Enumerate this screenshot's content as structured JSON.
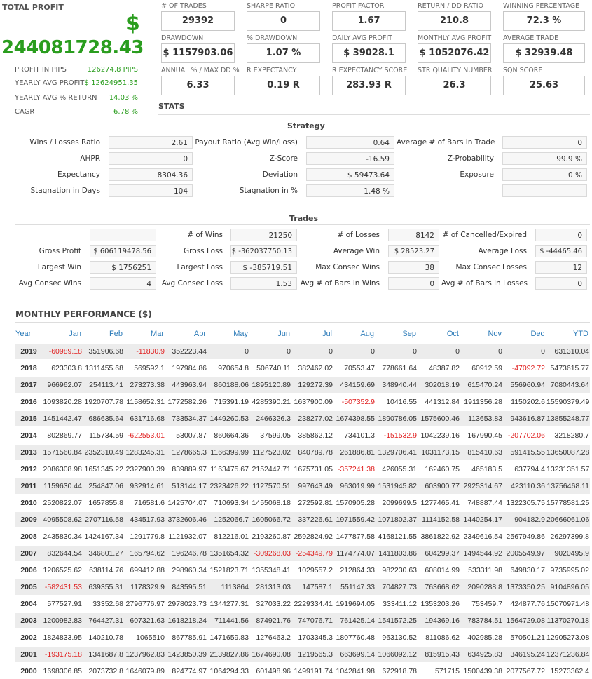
{
  "total_profit": {
    "title": "TOTAL PROFIT",
    "currency": "$",
    "value": "244081728.43"
  },
  "profit_stats": [
    {
      "label": "PROFIT IN PIPS",
      "value": "126274.8 PIPS"
    },
    {
      "label": "YEARLY AVG PROFIT",
      "value": "$ 12624951.35"
    },
    {
      "label": "YEARLY AVG % RETURN",
      "value": "14.03 %"
    },
    {
      "label": "CAGR",
      "value": "6.78 %"
    }
  ],
  "metrics": [
    {
      "label": "# OF TRADES",
      "value": "29392"
    },
    {
      "label": "SHARPE RATIO",
      "value": "0"
    },
    {
      "label": "PROFIT FACTOR",
      "value": "1.67"
    },
    {
      "label": "RETURN / DD RATIO",
      "value": "210.8"
    },
    {
      "label": "WINNING PERCENTAGE",
      "value": "72.3 %"
    },
    {
      "label": "DRAWDOWN",
      "value": "$ 1157903.06"
    },
    {
      "label": "% DRAWDOWN",
      "value": "1.07 %"
    },
    {
      "label": "DAILY AVG PROFIT",
      "value": "$ 39028.1"
    },
    {
      "label": "MONTHLY AVG PROFIT",
      "value": "$ 1052076.42"
    },
    {
      "label": "AVERAGE TRADE",
      "value": "$ 32939.48"
    },
    {
      "label": "ANNUAL % / MAX DD %",
      "value": "6.33"
    },
    {
      "label": "R EXPECTANCY",
      "value": "0.19 R"
    },
    {
      "label": "R EXPECTANCY SCORE",
      "value": "283.93 R"
    },
    {
      "label": "STR QUALITY NUMBER",
      "value": "26.3"
    },
    {
      "label": "SQN SCORE",
      "value": "25.63"
    }
  ],
  "stats_heading": "STATS",
  "strategy": {
    "title": "Strategy",
    "rows": [
      [
        {
          "label": "Wins / Losses Ratio",
          "value": "2.61"
        },
        {
          "label": "Payout Ratio (Avg Win/Loss)",
          "value": "0.64"
        },
        {
          "label": "Average # of Bars in Trade",
          "value": "0"
        }
      ],
      [
        {
          "label": "AHPR",
          "value": "0"
        },
        {
          "label": "Z-Score",
          "value": "-16.59"
        },
        {
          "label": "Z-Probability",
          "value": "99.9 %"
        }
      ],
      [
        {
          "label": "Expectancy",
          "value": "8304.36"
        },
        {
          "label": "Deviation",
          "value": "$ 59473.64"
        },
        {
          "label": "Exposure",
          "value": "0 %"
        }
      ],
      [
        {
          "label": "Stagnation in Days",
          "value": "104"
        },
        {
          "label": "Stagnation in %",
          "value": "1.48 %"
        },
        {
          "label": "",
          "value": ""
        }
      ]
    ]
  },
  "trades": {
    "title": "Trades",
    "rows": [
      [
        {
          "label": "",
          "value": ""
        },
        {
          "label": "# of Wins",
          "value": "21250"
        },
        {
          "label": "# of Losses",
          "value": "8142"
        },
        {
          "label": "# of Cancelled/Expired",
          "value": "0"
        }
      ],
      [
        {
          "label": "Gross Profit",
          "value": "$ 606119478.56"
        },
        {
          "label": "Gross Loss",
          "value": "$ -362037750.13"
        },
        {
          "label": "Average Win",
          "value": "$ 28523.27"
        },
        {
          "label": "Average Loss",
          "value": "$ -44465.46"
        }
      ],
      [
        {
          "label": "Largest Win",
          "value": "$ 1756251"
        },
        {
          "label": "Largest Loss",
          "value": "$ -385719.51"
        },
        {
          "label": "Max Consec Wins",
          "value": "38"
        },
        {
          "label": "Max Consec Losses",
          "value": "12"
        }
      ],
      [
        {
          "label": "Avg Consec Wins",
          "value": "4"
        },
        {
          "label": "Avg Consec Loss",
          "value": "1.53"
        },
        {
          "label": "Avg # of Bars in Wins",
          "value": "0"
        },
        {
          "label": "Avg # of Bars in Losses",
          "value": "0"
        }
      ]
    ]
  },
  "monthly": {
    "title": "MONTHLY PERFORMANCE ($)",
    "headers": [
      "Year",
      "Jan",
      "Feb",
      "Mar",
      "Apr",
      "May",
      "Jun",
      "Jul",
      "Aug",
      "Sep",
      "Oct",
      "Nov",
      "Dec",
      "YTD"
    ],
    "rows": [
      [
        "2019",
        "-60989.18",
        "351906.68",
        "-11830.9",
        "352223.44",
        "0",
        "0",
        "0",
        "0",
        "0",
        "0",
        "0",
        "0",
        "631310.04"
      ],
      [
        "2018",
        "623303.8",
        "1311455.68",
        "569592.1",
        "197984.86",
        "970654.8",
        "506740.11",
        "382462.02",
        "70553.47",
        "778661.64",
        "48387.82",
        "60912.59",
        "-47092.72",
        "5473615.77"
      ],
      [
        "2017",
        "966962.07",
        "254113.41",
        "273273.38",
        "443963.94",
        "860188.06",
        "1895120.89",
        "129272.39",
        "434159.69",
        "348940.44",
        "302018.19",
        "615470.24",
        "556960.94",
        "7080443.64"
      ],
      [
        "2016",
        "1093820.28",
        "1920707.78",
        "1158652.31",
        "1772582.26",
        "715391.19",
        "4285390.21",
        "1637900.09",
        "-507352.9",
        "10416.55",
        "441312.84",
        "1911356.28",
        "1150202.6",
        "15590379.49"
      ],
      [
        "2015",
        "1451442.47",
        "686635.64",
        "631716.68",
        "733534.37",
        "1449260.53",
        "2466326.3",
        "238277.02",
        "1674398.55",
        "1890786.05",
        "1575600.46",
        "113653.83",
        "943616.87",
        "13855248.77"
      ],
      [
        "2014",
        "802869.77",
        "115734.59",
        "-622553.01",
        "53007.87",
        "860664.36",
        "37599.05",
        "385862.12",
        "734101.3",
        "-151532.9",
        "1042239.16",
        "167990.45",
        "-207702.06",
        "3218280.7"
      ],
      [
        "2013",
        "1571560.84",
        "2352310.49",
        "1283245.31",
        "1278665.3",
        "1166399.99",
        "1127523.02",
        "840789.78",
        "261886.81",
        "1329706.41",
        "1031173.15",
        "815410.63",
        "591415.55",
        "13650087.28"
      ],
      [
        "2012",
        "2086308.98",
        "1651345.22",
        "2327900.39",
        "839889.97",
        "1163475.67",
        "2152447.71",
        "1675731.05",
        "-357241.38",
        "426055.31",
        "162460.75",
        "465183.5",
        "637794.4",
        "13231351.57"
      ],
      [
        "2011",
        "1159630.44",
        "254847.06",
        "932914.61",
        "513144.17",
        "2323426.22",
        "1127570.51",
        "997643.49",
        "963019.99",
        "1531945.82",
        "603900.77",
        "2925314.67",
        "423110.36",
        "13756468.11"
      ],
      [
        "2010",
        "2520822.07",
        "1657855.8",
        "716581.6",
        "1425704.07",
        "710693.34",
        "1455068.18",
        "272592.81",
        "1570905.28",
        "2099699.5",
        "1277465.41",
        "748887.44",
        "1322305.75",
        "15778581.25"
      ],
      [
        "2009",
        "4095508.62",
        "2707116.58",
        "434517.93",
        "3732606.46",
        "1252066.7",
        "1605066.72",
        "337226.61",
        "1971559.42",
        "1071802.37",
        "1114152.58",
        "1440254.17",
        "904182.9",
        "20666061.06"
      ],
      [
        "2008",
        "2435830.34",
        "1424167.34",
        "1291779.8",
        "1121932.07",
        "812216.01",
        "2193260.87",
        "2592824.92",
        "1477877.58",
        "4168121.55",
        "3861822.92",
        "2349616.54",
        "2567949.86",
        "26297399.8"
      ],
      [
        "2007",
        "832644.54",
        "346801.27",
        "165794.62",
        "196246.78",
        "1351654.32",
        "-309268.03",
        "-254349.79",
        "1174774.07",
        "1411803.86",
        "604299.37",
        "1494544.92",
        "2005549.97",
        "9020495.9"
      ],
      [
        "2006",
        "1206525.62",
        "638114.76",
        "699412.88",
        "298960.34",
        "1521823.71",
        "1355348.41",
        "1029557.2",
        "212864.33",
        "982230.63",
        "608014.99",
        "533311.98",
        "649830.17",
        "9735995.02"
      ],
      [
        "2005",
        "-582431.53",
        "639355.31",
        "1178329.9",
        "843595.51",
        "1113864",
        "281313.03",
        "147587.1",
        "551147.33",
        "704827.73",
        "763668.62",
        "2090288.8",
        "1373350.25",
        "9104896.05"
      ],
      [
        "2004",
        "577527.91",
        "33352.68",
        "2796776.97",
        "2978023.73",
        "1344277.31",
        "327033.22",
        "2229334.41",
        "1919694.05",
        "333411.12",
        "1353203.26",
        "753459.7",
        "424877.76",
        "15070971.48"
      ],
      [
        "2003",
        "1200982.83",
        "764427.31",
        "607321.63",
        "1618218.24",
        "711441.56",
        "874921.76",
        "747076.71",
        "761425.14",
        "1541572.25",
        "194369.16",
        "783784.51",
        "1564729.08",
        "11370270.18"
      ],
      [
        "2002",
        "1824833.95",
        "140210.78",
        "1065510",
        "867785.91",
        "1471659.83",
        "1276463.2",
        "1703345.3",
        "1807760.48",
        "963130.52",
        "811086.62",
        "402985.28",
        "570501.21",
        "12905273.08"
      ],
      [
        "2001",
        "-193175.18",
        "1341687.8",
        "1237962.83",
        "1423850.39",
        "2139827.86",
        "1674690.08",
        "1219565.3",
        "663699.14",
        "1066092.12",
        "815915.43",
        "634925.83",
        "346195.24",
        "12371236.84"
      ],
      [
        "2000",
        "1698306.85",
        "2073732.8",
        "1646079.89",
        "824774.97",
        "1064294.33",
        "601498.96",
        "1499191.74",
        "1042841.98",
        "672918.78",
        "571715",
        "1500439.38",
        "2077567.72",
        "15273362.4"
      ]
    ]
  }
}
